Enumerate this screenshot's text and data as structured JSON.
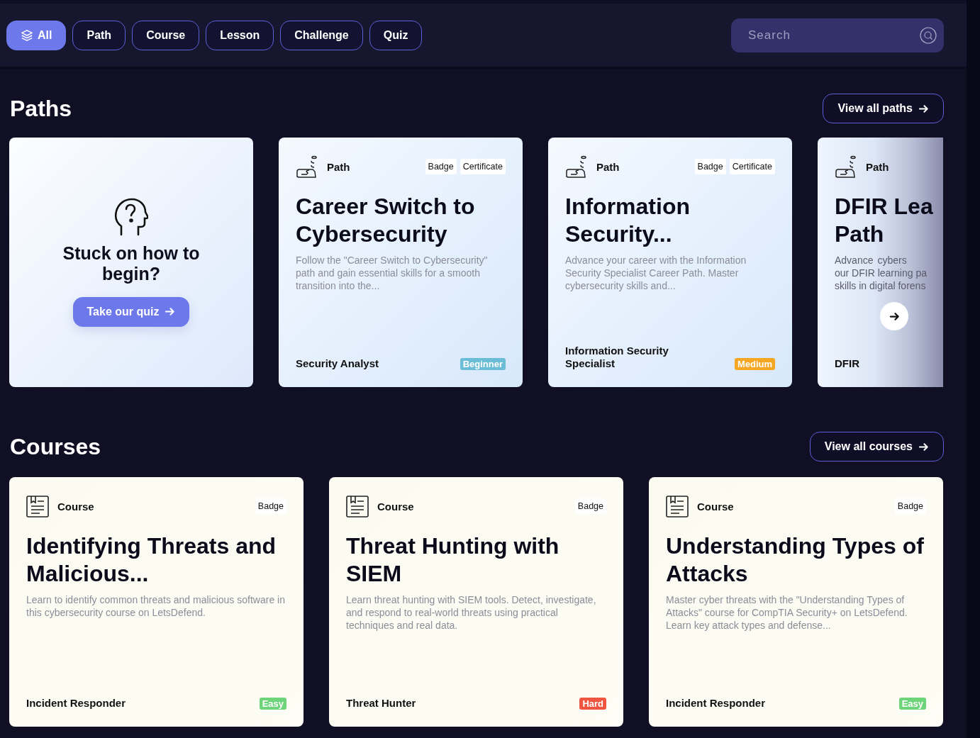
{
  "filters": [
    {
      "label": "All",
      "selected": true,
      "icon": true
    },
    {
      "label": "Path",
      "selected": false
    },
    {
      "label": "Course",
      "selected": false
    },
    {
      "label": "Lesson",
      "selected": false
    },
    {
      "label": "Challenge",
      "selected": false
    },
    {
      "label": "Quiz",
      "selected": false
    }
  ],
  "search": {
    "placeholder": "Search"
  },
  "paths": {
    "title": "Paths",
    "view_all": "View all paths",
    "quiz_card": {
      "heading": "Stuck on how to begin?",
      "button": "Take our quiz"
    },
    "cards": [
      {
        "type": "Path",
        "tags": [
          "Badge",
          "Certificate"
        ],
        "title": "Career Switch to Cybersecurity",
        "description": "Follow the \"Career Switch to Cybersecurity\" path and gain essential skills for a smooth transition into the...",
        "role": "Security Analyst",
        "level": {
          "label": "Beginner",
          "color": "#6bbcd6"
        }
      },
      {
        "type": "Path",
        "tags": [
          "Badge",
          "Certificate"
        ],
        "title": "Information Security...",
        "description": "Advance your career with the Information Security Specialist Career Path. Master cybersecurity skills and...",
        "role": "Information Security Specialist",
        "level": {
          "label": "Medium",
          "color": "#f5a623"
        }
      }
    ],
    "peek_card": {
      "type": "Path",
      "title": "DFIR Lea Path",
      "desc_lead": "Advance",
      "desc_after": "cybers",
      "desc_lines": [
        "our DFIR learning pa",
        "skills in digital forens"
      ],
      "role": "DFIR"
    }
  },
  "courses": {
    "title": "Courses",
    "view_all": "View all courses",
    "cards": [
      {
        "type": "Course",
        "tags": [
          "Badge"
        ],
        "title": "Identifying Threats and Malicious...",
        "description": "Learn to identify common threats and malicious software in this cybersecurity course on LetsDefend.",
        "role": "Incident Responder",
        "level": {
          "label": "Easy",
          "color": "#6dd47a"
        }
      },
      {
        "type": "Course",
        "tags": [
          "Badge"
        ],
        "title": "Threat Hunting with SIEM",
        "description": "Learn threat hunting with SIEM tools. Detect, investigate, and respond to real-world threats using practical techniques and real data.",
        "role": "Threat Hunter",
        "level": {
          "label": "Hard",
          "color": "#f0553f"
        }
      },
      {
        "type": "Course",
        "tags": [
          "Badge"
        ],
        "title": "Understanding Types of Attacks",
        "description": "Master cyber threats with the \"Understanding Types of Attacks\" course for CompTIA Security+ on LetsDefend. Learn key attack types and defense...",
        "role": "Incident Responder",
        "level": {
          "label": "Easy",
          "color": "#6dd47a"
        }
      }
    ]
  }
}
